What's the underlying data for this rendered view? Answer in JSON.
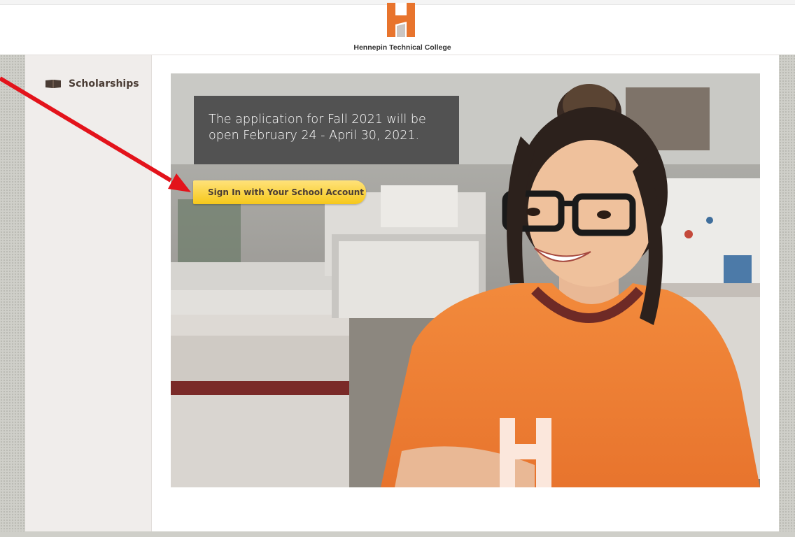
{
  "header": {
    "logo_letter": "H",
    "college_name": "Hennepin Technical College"
  },
  "sidebar": {
    "items": [
      {
        "label": "Scholarships",
        "icon": "book-icon"
      }
    ]
  },
  "hero": {
    "notice_text": "The application for Fall 2021 will be open February 24 - April 30, 2021.",
    "signin_label": "Sign In with Your School Account",
    "shirt_letter": "H"
  },
  "colors": {
    "brand_orange": "#e8742d",
    "button_yellow": "#f6c81a",
    "annotation_red": "#e3131b",
    "sidebar_bg": "#f0edeb"
  }
}
